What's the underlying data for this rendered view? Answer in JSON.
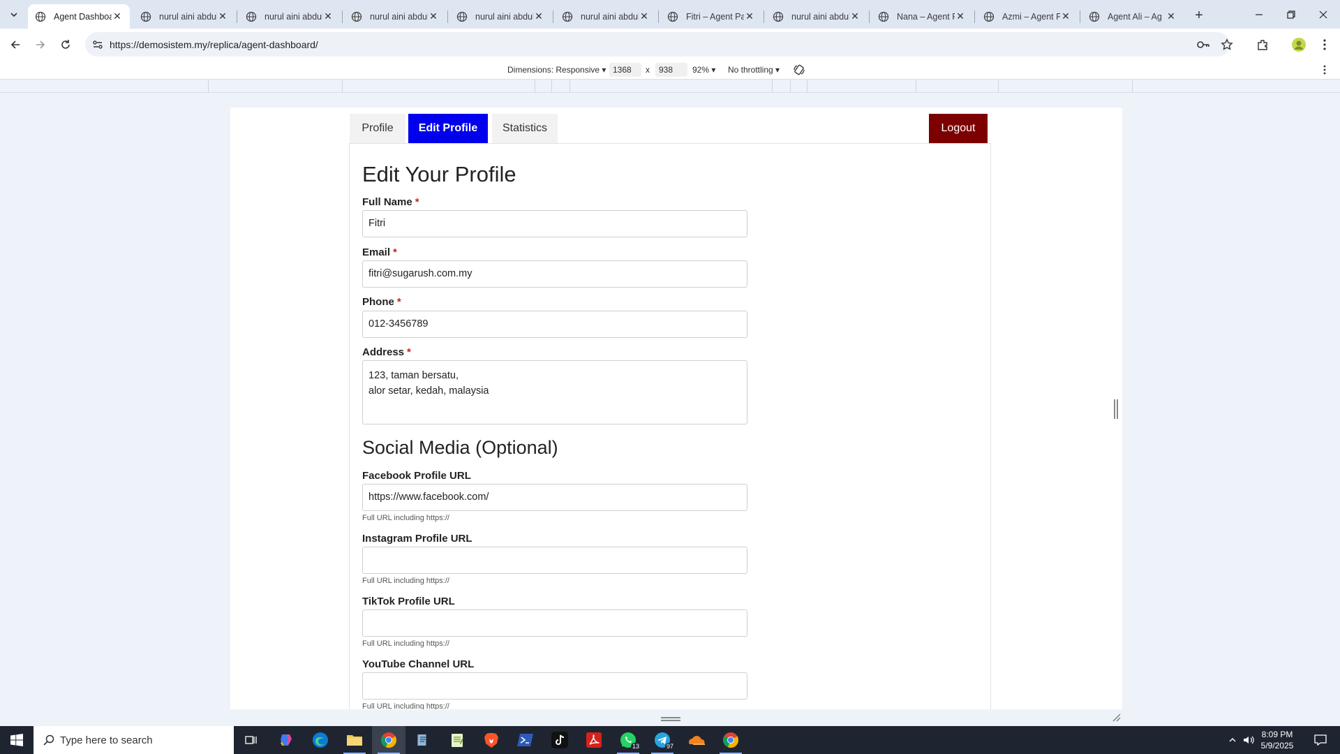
{
  "browser": {
    "tabs": [
      {
        "label": "Agent Dashboard",
        "active": true
      },
      {
        "label": "nurul aini abdul",
        "active": false
      },
      {
        "label": "nurul aini abdul",
        "active": false
      },
      {
        "label": "nurul aini abdul",
        "active": false
      },
      {
        "label": "nurul aini abdul",
        "active": false
      },
      {
        "label": "nurul aini abdul",
        "active": false
      },
      {
        "label": "Fitri – Agent Pa",
        "active": false
      },
      {
        "label": "nurul aini abdul",
        "active": false
      },
      {
        "label": "Nana – Agent P",
        "active": false
      },
      {
        "label": "Azmi – Agent P",
        "active": false
      },
      {
        "label": "Agent Ali – Ag",
        "active": false
      }
    ],
    "url": "https://demosistem.my/replica/agent-dashboard/"
  },
  "devtools": {
    "dimensions_label": "Dimensions: Responsive",
    "width": "1368",
    "times": "x",
    "height": "938",
    "zoom": "92%",
    "throttling": "No throttling"
  },
  "page": {
    "tabs": {
      "profile": "Profile",
      "edit_profile": "Edit Profile",
      "statistics": "Statistics"
    },
    "logout": "Logout",
    "heading": "Edit Your Profile",
    "required_mark": "*",
    "fields": {
      "full_name": {
        "label": "Full Name",
        "value": "Fitri"
      },
      "email": {
        "label": "Email",
        "value": "fitri@sugarush.com.my"
      },
      "phone": {
        "label": "Phone",
        "value": "012-3456789"
      },
      "address": {
        "label": "Address",
        "value": "123, taman bersatu,\nalor setar, kedah, malaysia"
      }
    },
    "social_heading": "Social Media (Optional)",
    "social": {
      "facebook": {
        "label": "Facebook Profile URL",
        "value": "https://www.facebook.com/",
        "hint": "Full URL including https://"
      },
      "instagram": {
        "label": "Instagram Profile URL",
        "value": "",
        "hint": "Full URL including https://"
      },
      "tiktok": {
        "label": "TikTok Profile URL",
        "value": "",
        "hint": "Full URL including https://"
      },
      "youtube": {
        "label": "YouTube Channel URL",
        "value": "",
        "hint": "Full URL including https://"
      }
    }
  },
  "taskbar": {
    "search_placeholder": "Type here to search",
    "whatsapp_badge": "13",
    "telegram_badge": "97",
    "time": "8:09 PM",
    "date": "5/9/2025"
  },
  "colors": {
    "accent_tab": "#0000ee",
    "logout": "#7d0000",
    "required": "#cc1f1f"
  }
}
